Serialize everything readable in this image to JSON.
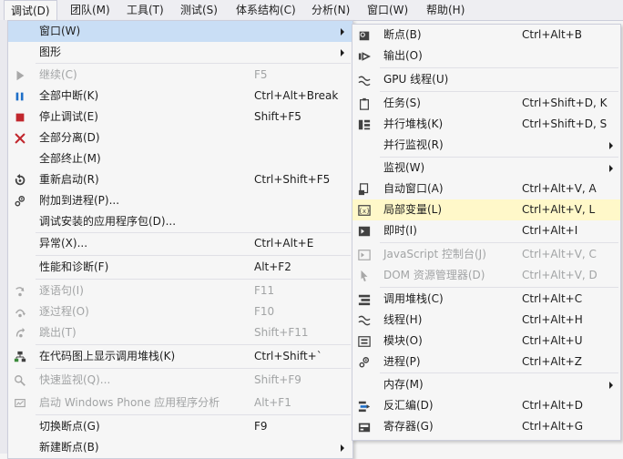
{
  "menubar": {
    "items": [
      "调试(D)",
      "团队(M)",
      "工具(T)",
      "测试(S)",
      "体系结构(C)",
      "分析(N)",
      "窗口(W)",
      "帮助(H)"
    ]
  },
  "debug_menu": {
    "items": [
      {
        "label": "窗口(W)",
        "shortcut": "",
        "submenu": true,
        "icon": "",
        "state": "active"
      },
      {
        "label": "图形",
        "shortcut": "",
        "submenu": true,
        "icon": "",
        "state": "normal"
      },
      {
        "label": "继续(C)",
        "shortcut": "F5",
        "submenu": false,
        "icon": "play-icon",
        "state": "disabled"
      },
      {
        "label": "全部中断(K)",
        "shortcut": "Ctrl+Alt+Break",
        "submenu": false,
        "icon": "pause-icon",
        "state": "normal"
      },
      {
        "label": "停止调试(E)",
        "shortcut": "Shift+F5",
        "submenu": false,
        "icon": "stop-icon",
        "state": "normal"
      },
      {
        "label": "全部分离(D)",
        "shortcut": "",
        "submenu": false,
        "icon": "detach-x-icon",
        "state": "normal"
      },
      {
        "label": "全部终止(M)",
        "shortcut": "",
        "submenu": false,
        "icon": "",
        "state": "normal"
      },
      {
        "label": "重新启动(R)",
        "shortcut": "Ctrl+Shift+F5",
        "submenu": false,
        "icon": "restart-icon",
        "state": "normal"
      },
      {
        "label": "附加到进程(P)...",
        "shortcut": "",
        "submenu": false,
        "icon": "attach-process-icon",
        "state": "normal"
      },
      {
        "label": "调试安装的应用程序包(D)...",
        "shortcut": "",
        "submenu": false,
        "icon": "",
        "state": "normal"
      },
      {
        "label": "异常(X)...",
        "shortcut": "Ctrl+Alt+E",
        "submenu": false,
        "icon": "",
        "state": "normal"
      },
      {
        "label": "性能和诊断(F)",
        "shortcut": "Alt+F2",
        "submenu": false,
        "icon": "",
        "state": "normal"
      },
      {
        "label": "逐语句(I)",
        "shortcut": "F11",
        "submenu": false,
        "icon": "step-into-icon",
        "state": "disabled"
      },
      {
        "label": "逐过程(O)",
        "shortcut": "F10",
        "submenu": false,
        "icon": "step-over-icon",
        "state": "disabled"
      },
      {
        "label": "跳出(T)",
        "shortcut": "Shift+F11",
        "submenu": false,
        "icon": "step-out-icon",
        "state": "disabled"
      },
      {
        "label": "在代码图上显示调用堆栈(K)",
        "shortcut": "Ctrl+Shift+`",
        "submenu": false,
        "icon": "code-map-icon",
        "state": "normal"
      },
      {
        "label": "快速监视(Q)...",
        "shortcut": "Shift+F9",
        "submenu": false,
        "icon": "quick-watch-icon",
        "state": "disabled"
      },
      {
        "label": "启动 Windows Phone 应用程序分析",
        "shortcut": "Alt+F1",
        "submenu": false,
        "icon": "phone-analysis-icon",
        "state": "disabled"
      },
      {
        "label": "切换断点(G)",
        "shortcut": "F9",
        "submenu": false,
        "icon": "",
        "state": "normal"
      },
      {
        "label": "新建断点(B)",
        "shortcut": "",
        "submenu": true,
        "icon": "",
        "state": "normal"
      }
    ]
  },
  "window_submenu": {
    "items": [
      {
        "label": "断点(B)",
        "shortcut": "Ctrl+Alt+B",
        "submenu": false,
        "icon": "breakpoints-icon",
        "state": "normal"
      },
      {
        "label": "输出(O)",
        "shortcut": "",
        "submenu": false,
        "icon": "output-icon",
        "state": "normal"
      },
      {
        "label": "GPU 线程(U)",
        "shortcut": "",
        "submenu": false,
        "icon": "gpu-threads-icon",
        "state": "normal"
      },
      {
        "label": "任务(S)",
        "shortcut": "Ctrl+Shift+D, K",
        "submenu": false,
        "icon": "tasks-icon",
        "state": "normal"
      },
      {
        "label": "并行堆栈(K)",
        "shortcut": "Ctrl+Shift+D, S",
        "submenu": false,
        "icon": "parallel-stacks-icon",
        "state": "normal"
      },
      {
        "label": "并行监视(R)",
        "shortcut": "",
        "submenu": true,
        "icon": "",
        "state": "normal"
      },
      {
        "label": "监视(W)",
        "shortcut": "",
        "submenu": true,
        "icon": "",
        "state": "normal"
      },
      {
        "label": "自动窗口(A)",
        "shortcut": "Ctrl+Alt+V, A",
        "submenu": false,
        "icon": "autos-icon",
        "state": "normal"
      },
      {
        "label": "局部变量(L)",
        "shortcut": "Ctrl+Alt+V, L",
        "submenu": false,
        "icon": "locals-icon",
        "state": "highlighted"
      },
      {
        "label": "即时(I)",
        "shortcut": "Ctrl+Alt+I",
        "submenu": false,
        "icon": "immediate-icon",
        "state": "normal"
      },
      {
        "label": "JavaScript 控制台(J)",
        "shortcut": "Ctrl+Alt+V, C",
        "submenu": false,
        "icon": "js-console-icon",
        "state": "disabled"
      },
      {
        "label": "DOM 资源管理器(D)",
        "shortcut": "Ctrl+Alt+V, D",
        "submenu": false,
        "icon": "dom-explorer-icon",
        "state": "disabled"
      },
      {
        "label": "调用堆栈(C)",
        "shortcut": "Ctrl+Alt+C",
        "submenu": false,
        "icon": "call-stack-icon",
        "state": "normal"
      },
      {
        "label": "线程(H)",
        "shortcut": "Ctrl+Alt+H",
        "submenu": false,
        "icon": "threads-icon",
        "state": "normal"
      },
      {
        "label": "模块(O)",
        "shortcut": "Ctrl+Alt+U",
        "submenu": false,
        "icon": "modules-icon",
        "state": "normal"
      },
      {
        "label": "进程(P)",
        "shortcut": "Ctrl+Alt+Z",
        "submenu": false,
        "icon": "processes-icon",
        "state": "normal"
      },
      {
        "label": "内存(M)",
        "shortcut": "",
        "submenu": true,
        "icon": "",
        "state": "normal"
      },
      {
        "label": "反汇编(D)",
        "shortcut": "Ctrl+Alt+D",
        "submenu": false,
        "icon": "disassembly-icon",
        "state": "normal"
      },
      {
        "label": "寄存器(G)",
        "shortcut": "Ctrl+Alt+G",
        "submenu": false,
        "icon": "registers-icon",
        "state": "normal"
      }
    ]
  },
  "colors": {
    "highlight": "#fff8c9",
    "active": "#c9def5",
    "disabled_text": "#a2a4a5",
    "pause_blue": "#1e6fc8",
    "stop_red": "#c1272d"
  }
}
